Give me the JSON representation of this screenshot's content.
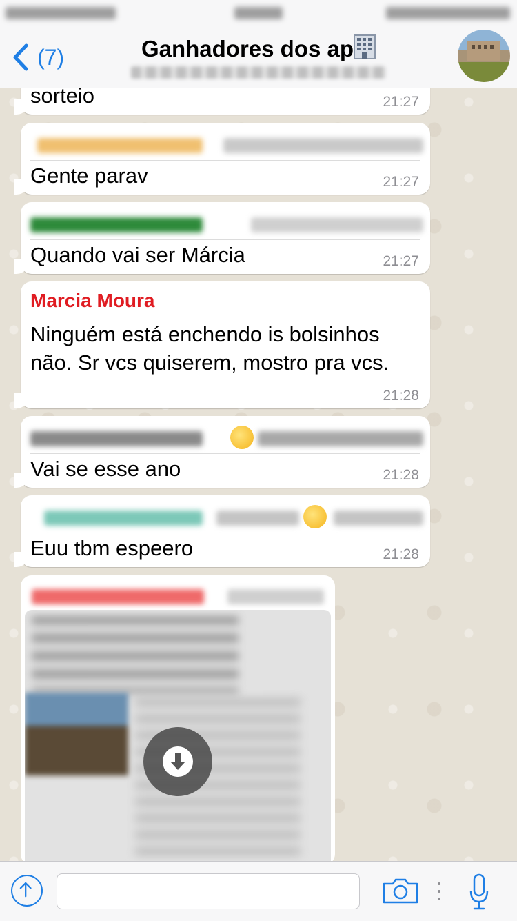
{
  "nav": {
    "back_count": "(7)",
    "title": "Ganhadores dos ap"
  },
  "messages": [
    {
      "text": "sorteio",
      "time": "21:27"
    },
    {
      "text": "Gente parav",
      "time": "21:27"
    },
    {
      "text": "Quando vai ser Márcia",
      "time": "21:27"
    },
    {
      "sender": "Marcia Moura",
      "text": "Ninguém está enchendo is bolsinhos não.  Sr vcs quiserem, mostro pra vcs.",
      "time": "21:28"
    },
    {
      "text": "Vai se esse ano",
      "time": "21:28"
    },
    {
      "text": "Euu tbm espeero",
      "time": "21:28"
    }
  ],
  "colors": {
    "accent": "#1f7fe5",
    "sender_name": "#e01c22",
    "time": "#8e8e93"
  },
  "icons": {
    "back": "chevron-left-icon",
    "share": "share-arrow-icon",
    "camera": "camera-icon",
    "mic": "microphone-icon",
    "download": "download-arrow-icon"
  }
}
